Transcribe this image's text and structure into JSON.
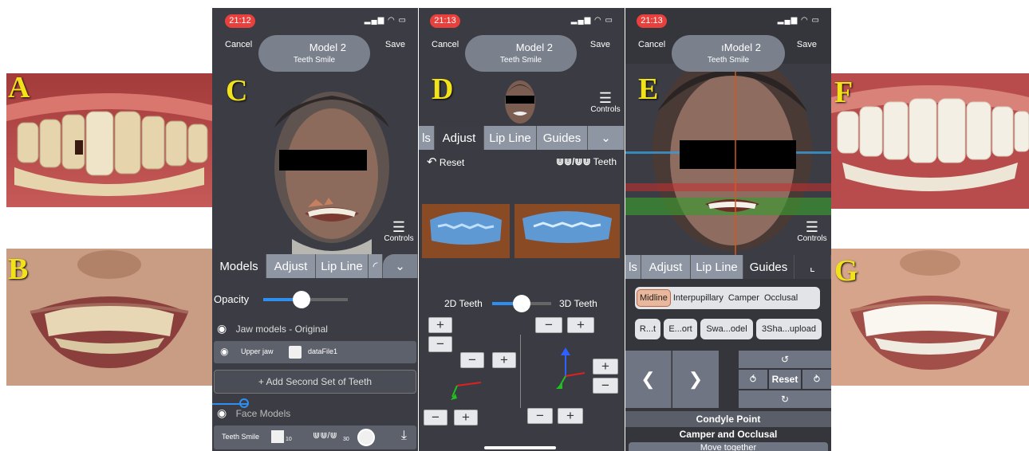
{
  "panel_letters": {
    "a": "A",
    "b": "B",
    "c": "C",
    "d": "D",
    "e": "E",
    "f": "F",
    "g": "G"
  },
  "phone_c": {
    "time": "21:12",
    "cancel": "Cancel",
    "save": "Save",
    "model_title": "Model 2",
    "model_subtitle": "Teeth Smile",
    "controls_label": "Controls",
    "tabs": [
      "Models",
      "Adjust",
      "Lip Line"
    ],
    "opacity_label": "Opacity",
    "opacity_value": 0.45,
    "jaw_section": "Jaw models - Original",
    "upper_jaw": "Upper jaw",
    "data_file": "dataFile1",
    "add_second": "+ Add Second Set of Teeth",
    "face_section": "Face Models",
    "teeth_smile_chip": "Teeth Smile",
    "small_num_10": "10",
    "small_num_30": "30"
  },
  "phone_d": {
    "time": "21:13",
    "cancel": "Cancel",
    "save": "Save",
    "model_title": "Model 2",
    "model_subtitle": "Teeth Smile",
    "controls_label": "Controls",
    "tabs": [
      "ls",
      "Adjust",
      "Lip Line",
      "Guides"
    ],
    "reset": "Reset",
    "teeth": "Teeth",
    "label_2d": "2D Teeth",
    "label_3d": "3D Teeth",
    "slider_value": 0.5,
    "plus": "+",
    "minus": "−"
  },
  "phone_e": {
    "time": "21:13",
    "cancel": "Cancel",
    "save": "Save",
    "model_title": "Model 2",
    "model_prefix": "ı",
    "model_subtitle": "Teeth Smile",
    "controls_label": "Controls",
    "tabs": [
      "ls",
      "Adjust",
      "Lip Line",
      "Guides"
    ],
    "guide_tabs": [
      "Midline",
      "Interpupillary",
      "Camper",
      "Occlusal"
    ],
    "actions": [
      "R...t",
      "E...ort",
      "Swa...odel",
      "3Sha...upload"
    ],
    "reset": "Reset",
    "condyle": "Condyle Point",
    "camper_occlusal": "Camper and Occlusal",
    "move_together": "Move together"
  },
  "colors": {
    "app_bg": "#3c3d44",
    "accent_blue": "#2f8ff0",
    "status_red": "#e8413d",
    "tab_light": "#8f96a3",
    "guide_active": "#e9b79c",
    "letter_yellow": "#f2e21a"
  }
}
